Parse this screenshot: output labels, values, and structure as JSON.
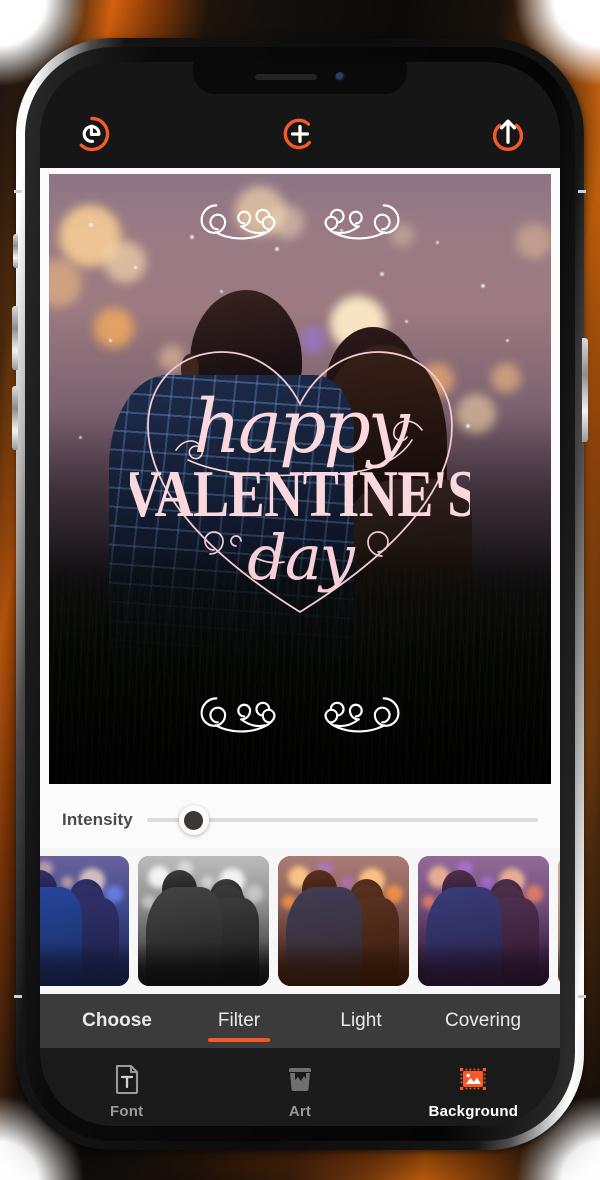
{
  "app": {
    "device": "smartphone",
    "accent_color": "#F4592A",
    "screen_bg": "#161616",
    "panel_bg": "#FBFBFB"
  },
  "toolbar": {
    "undo": {
      "name": "undo",
      "label": "Undo"
    },
    "add": {
      "name": "add",
      "label": "Add"
    },
    "export": {
      "name": "export",
      "label": "Export"
    }
  },
  "canvas": {
    "design_title": "Happy Valentine's Day card",
    "overlay_text": {
      "line1": "happy",
      "line2": "VALENTINE'S",
      "line3": "day"
    },
    "text_color": "#F9D8DE",
    "ornament_top": "swirl-flourish",
    "ornament_bottom": "swirl-flourish",
    "heart_outline_color": "#F3C9D2",
    "photo_description": "Couple silhouetted against night bokeh lights with falling snow"
  },
  "intensity": {
    "label": "Intensity",
    "value": 12,
    "min": 0,
    "max": 100
  },
  "filters": [
    {
      "id": "filter-1",
      "name": "cool-blue",
      "selected": false
    },
    {
      "id": "filter-2",
      "name": "mono",
      "selected": false
    },
    {
      "id": "filter-3",
      "name": "warm-glow",
      "selected": true
    },
    {
      "id": "filter-4",
      "name": "dusk-violet",
      "selected": false
    },
    {
      "id": "filter-5",
      "name": "faded-sepia",
      "selected": false
    }
  ],
  "subtabs": [
    {
      "label": "Choose",
      "active": false,
      "strong": true
    },
    {
      "label": "Filter",
      "active": true,
      "strong": false
    },
    {
      "label": "Light",
      "active": false,
      "strong": false
    },
    {
      "label": "Covering",
      "active": false,
      "strong": false
    }
  ],
  "bottom_nav": [
    {
      "label": "Font",
      "icon": "font-icon",
      "active": false
    },
    {
      "label": "Art",
      "icon": "art-icon",
      "active": false
    },
    {
      "label": "Background",
      "icon": "background-icon",
      "active": true
    }
  ]
}
